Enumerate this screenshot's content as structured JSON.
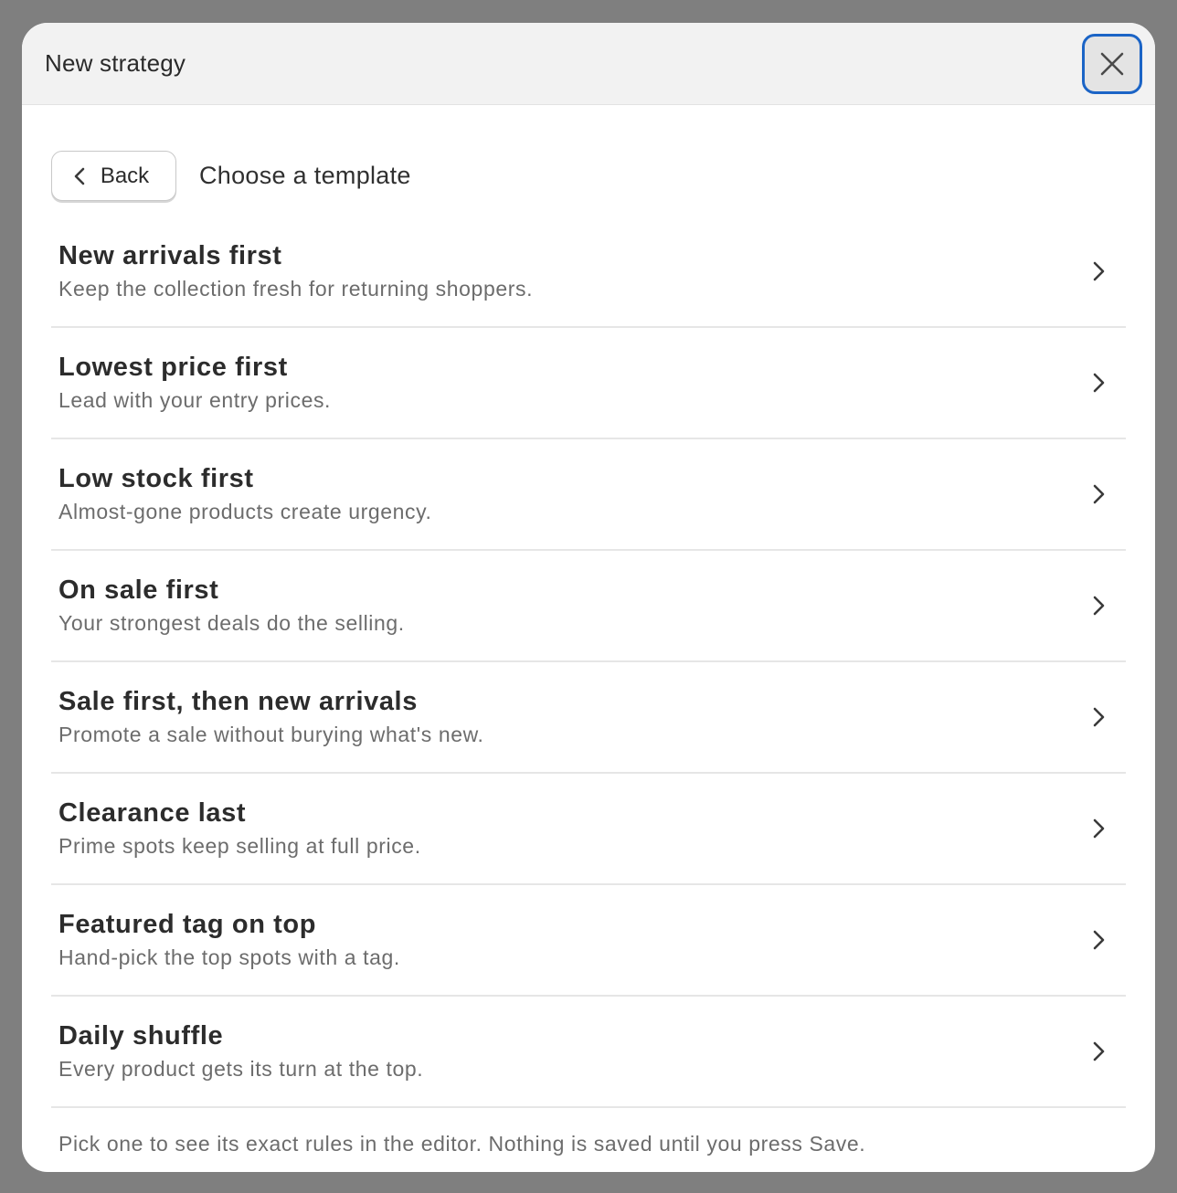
{
  "modal": {
    "title": "New strategy",
    "close_icon": "close-icon"
  },
  "toolbar": {
    "back_label": "Back",
    "back_icon": "chevron-left-icon",
    "heading": "Choose a template"
  },
  "templates": [
    {
      "title": "New arrivals first",
      "description": "Keep the collection fresh for returning shoppers."
    },
    {
      "title": "Lowest price first",
      "description": "Lead with your entry prices."
    },
    {
      "title": "Low stock first",
      "description": "Almost-gone products create urgency."
    },
    {
      "title": "On sale first",
      "description": "Your strongest deals do the selling."
    },
    {
      "title": "Sale first, then new arrivals",
      "description": "Promote a sale without burying what's new."
    },
    {
      "title": "Clearance last",
      "description": "Prime spots keep selling at full price."
    },
    {
      "title": "Featured tag on top",
      "description": "Hand-pick the top spots with a tag."
    },
    {
      "title": "Daily shuffle",
      "description": "Every product gets its turn at the top."
    }
  ],
  "footnote": "Pick one to see its exact rules in the editor. Nothing is saved until you press Save.",
  "colors": {
    "backdrop": "#7f7f7f",
    "focus_ring": "#1b64c6"
  }
}
